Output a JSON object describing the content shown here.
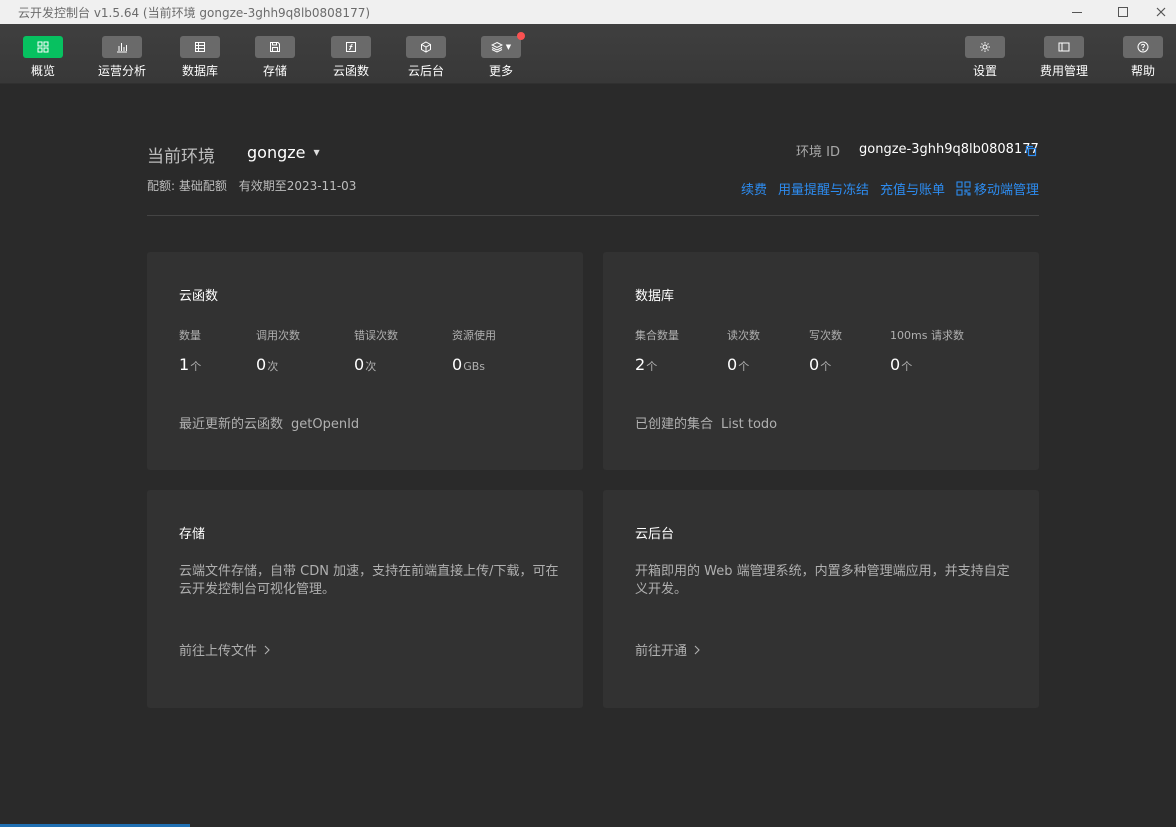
{
  "window": {
    "title": "云开发控制台 v1.5.64 (当前环境 gongze-3ghh9q8lb0808177)"
  },
  "toolbar": {
    "left": [
      {
        "label": "概览",
        "icon": "grid-icon",
        "active": true
      },
      {
        "label": "运营分析",
        "icon": "bar-chart-icon"
      },
      {
        "label": "数据库",
        "icon": "database-icon"
      },
      {
        "label": "存储",
        "icon": "floppy-icon"
      },
      {
        "label": "云函数",
        "icon": "function-icon"
      },
      {
        "label": "云后台",
        "icon": "cube-icon"
      },
      {
        "label": "更多",
        "icon": "layers-icon",
        "badge": true
      }
    ],
    "right": [
      {
        "label": "设置",
        "icon": "gear-icon"
      },
      {
        "label": "费用管理",
        "icon": "billing-icon"
      },
      {
        "label": "帮助",
        "icon": "help-icon"
      }
    ]
  },
  "env": {
    "label": "当前环境",
    "name": "gongze",
    "quota_label": "配额: 基础配额",
    "expiry": "有效期至2023-11-03",
    "id_label": "环境 ID",
    "id_value": "gongze-3ghh9q8lb0808177"
  },
  "links": {
    "renew": "续费",
    "usage_alert": "用量提醒与冻结",
    "recharge": "充值与账单",
    "mobile": "移动端管理"
  },
  "cards": {
    "functions": {
      "title": "云函数",
      "stats": [
        {
          "label": "数量",
          "value": "1",
          "unit": "个"
        },
        {
          "label": "调用次数",
          "value": "0",
          "unit": "次"
        },
        {
          "label": "错误次数",
          "value": "0",
          "unit": "次"
        },
        {
          "label": "资源使用",
          "value": "0",
          "unit": "GBs"
        }
      ],
      "footer_label": "最近更新的云函数",
      "footer_value": "getOpenId"
    },
    "database": {
      "title": "数据库",
      "stats": [
        {
          "label": "集合数量",
          "value": "2",
          "unit": "个"
        },
        {
          "label": "读次数",
          "value": "0",
          "unit": "个"
        },
        {
          "label": "写次数",
          "value": "0",
          "unit": "个"
        },
        {
          "label": "100ms 请求数",
          "value": "0",
          "unit": "个"
        }
      ],
      "footer_label": "已创建的集合",
      "footer_value": "List todo"
    },
    "storage": {
      "title": "存储",
      "desc": "云端文件存储，自带 CDN 加速，支持在前端直接上传/下载，可在云开发控制台可视化管理。",
      "action": "前往上传文件"
    },
    "backend": {
      "title": "云后台",
      "desc": "开箱即用的 Web 端管理系统，内置多种管理端应用，并支持自定义开发。",
      "action": "前往开通"
    }
  },
  "colors": {
    "accent_green": "#07c160",
    "link_blue": "#2d8cf0",
    "badge_red": "#fa5151",
    "background": "#2a2a2a",
    "card": "#323232"
  }
}
